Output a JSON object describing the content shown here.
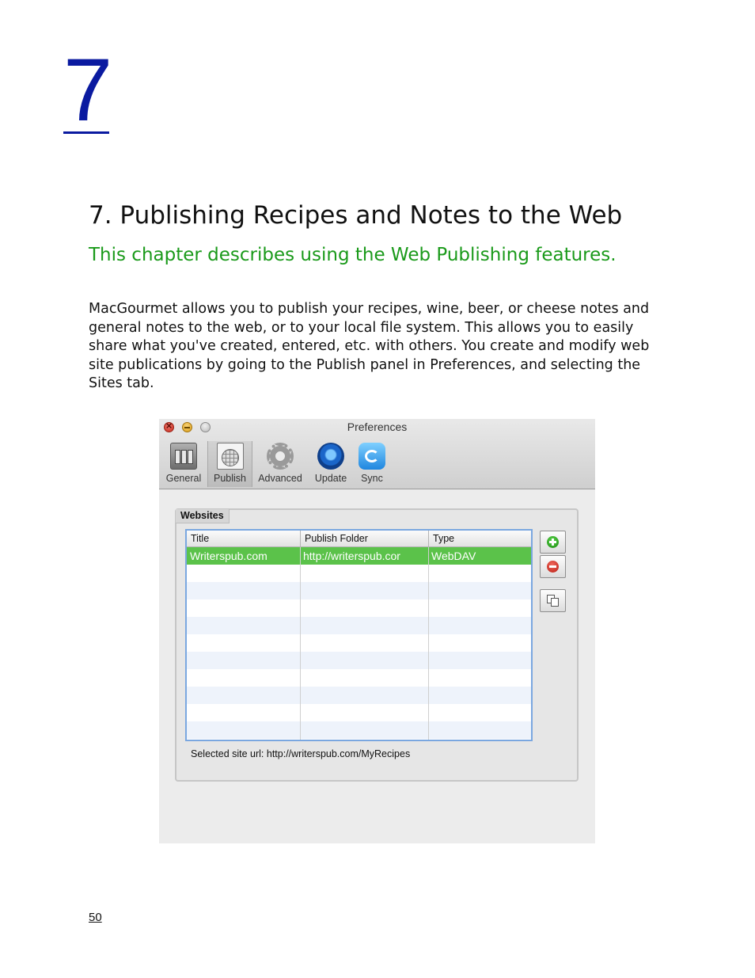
{
  "chapter": {
    "number": "7",
    "title": "7. Publishing Recipes and Notes to the Web",
    "subtitle": "This chapter describes using the Web Publishing features.",
    "intro": "MacGourmet allows you to publish your recipes, wine, beer, or cheese notes and general notes to the web, or to your local file system. This allows you to easily share what you've created, entered, etc. with others. You create and modify web site publications by going to the Publish panel in Preferences, and selecting the Sites tab."
  },
  "window": {
    "title": "Preferences",
    "toolbar": [
      {
        "label": "General",
        "icon": "general-icon"
      },
      {
        "label": "Publish",
        "icon": "publish-globe-icon",
        "selected": true
      },
      {
        "label": "Advanced",
        "icon": "gear-icon"
      },
      {
        "label": "Update",
        "icon": "update-icon"
      },
      {
        "label": "Sync",
        "icon": "sync-cloud-icon"
      }
    ],
    "tab_label": "Websites",
    "table": {
      "columns": [
        "Title",
        "Publish Folder",
        "Type"
      ],
      "rows": [
        {
          "title": "Writerspub.com",
          "folder": "http://writerspub.cor",
          "type": "WebDAV",
          "selected": true
        }
      ]
    },
    "selected_site_url": "Selected site url:  http://writerspub.com/MyRecipes",
    "colors": {
      "selection": "#5bc24a",
      "focus_ring": "#7aa7e0",
      "add": "#1a8a10",
      "remove": "#b81c12"
    }
  },
  "page_number": "50"
}
